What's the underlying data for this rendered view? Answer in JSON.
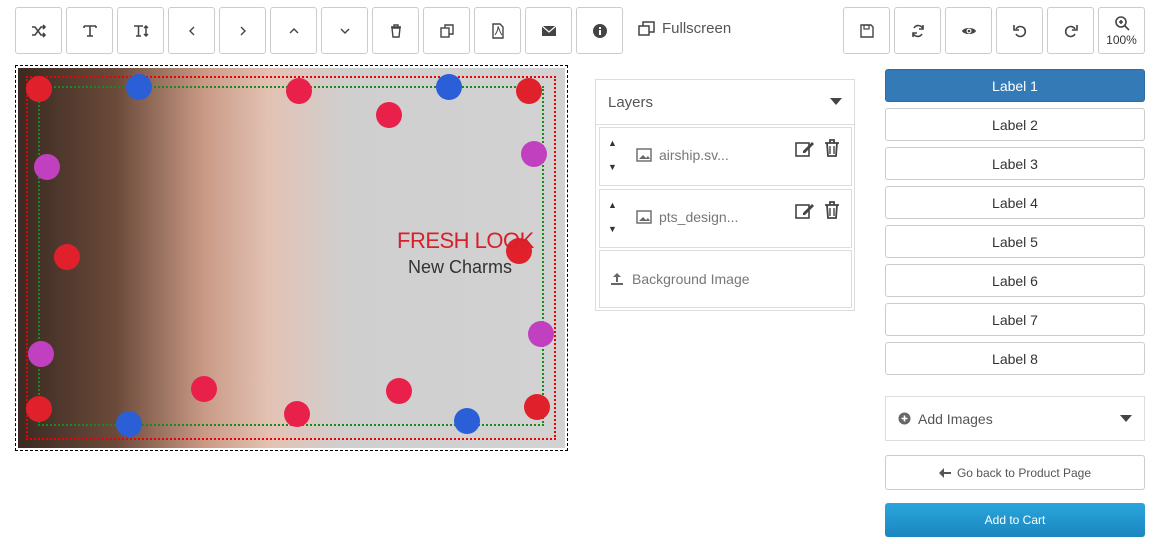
{
  "toolbar": {
    "tools": [
      {
        "name": "shuffle-icon"
      },
      {
        "name": "text-icon"
      },
      {
        "name": "text-size-icon"
      },
      {
        "name": "chevron-left-icon"
      },
      {
        "name": "chevron-right-icon"
      },
      {
        "name": "chevron-up-icon"
      },
      {
        "name": "chevron-down-icon"
      },
      {
        "name": "trash-icon"
      },
      {
        "name": "duplicate-icon"
      },
      {
        "name": "pdf-icon"
      },
      {
        "name": "envelope-icon"
      },
      {
        "name": "info-icon"
      }
    ],
    "fullscreen_label": "Fullscreen",
    "right_tools": [
      {
        "name": "save-icon"
      },
      {
        "name": "refresh-icon"
      },
      {
        "name": "preview-eye-icon"
      },
      {
        "name": "undo-icon"
      },
      {
        "name": "redo-icon"
      }
    ],
    "zoom_level": "100%"
  },
  "canvas": {
    "headline": "FRESH LOOK",
    "subline": "New Charms"
  },
  "layers": {
    "title": "Layers",
    "items": [
      {
        "name": "airship.sv..."
      },
      {
        "name": "pts_design..."
      }
    ],
    "background_label": "Background Image"
  },
  "labels": [
    "Label 1",
    "Label 2",
    "Label 3",
    "Label 4",
    "Label 5",
    "Label 6",
    "Label 7",
    "Label 8"
  ],
  "add_images_label": "Add Images",
  "back_label": "Go back to Product Page",
  "cart_label": "Add to Cart",
  "colors": {
    "accent": "#337ab7",
    "cart": "#1f94cf",
    "headline": "#d8202a"
  }
}
